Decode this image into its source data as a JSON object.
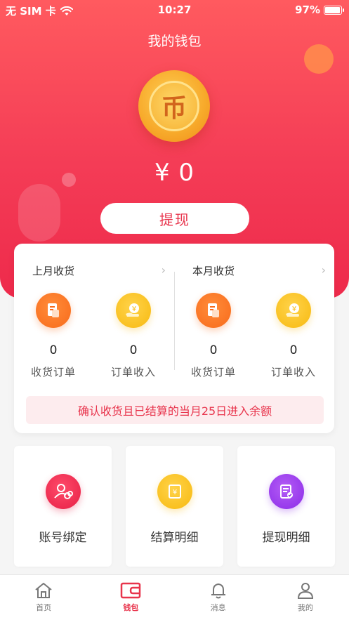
{
  "status_bar": {
    "carrier": "无 SIM 卡",
    "time": "10:27",
    "battery": "97%"
  },
  "header": {
    "title": "我的钱包",
    "coin_glyph": "币",
    "balance": "¥ 0",
    "withdraw_label": "提现"
  },
  "stats": {
    "last_month": {
      "title": "上月收货",
      "items": [
        {
          "value": "0",
          "label": "收货订单",
          "icon": "order-doc-icon"
        },
        {
          "value": "0",
          "label": "订单收入",
          "icon": "income-hand-icon"
        }
      ]
    },
    "this_month": {
      "title": "本月收货",
      "items": [
        {
          "value": "0",
          "label": "收货订单",
          "icon": "order-doc-icon"
        },
        {
          "value": "0",
          "label": "订单收入",
          "icon": "income-hand-icon"
        }
      ]
    },
    "notice": "确认收货且已结算的当月25日进入余额"
  },
  "tiles": [
    {
      "label": "账号绑定",
      "icon": "account-link-icon"
    },
    {
      "label": "结算明细",
      "icon": "settlement-icon"
    },
    {
      "label": "提现明细",
      "icon": "withdraw-detail-icon"
    }
  ],
  "tabbar": [
    {
      "label": "首页",
      "icon": "home-icon",
      "active": false
    },
    {
      "label": "钱包",
      "icon": "wallet-icon",
      "active": true
    },
    {
      "label": "消息",
      "icon": "bell-icon",
      "active": false
    },
    {
      "label": "我的",
      "icon": "user-icon",
      "active": false
    }
  ],
  "colors": {
    "brand": "#ee2a4b",
    "accent_text": "#e8344c",
    "notice_bg": "#fdecee"
  }
}
